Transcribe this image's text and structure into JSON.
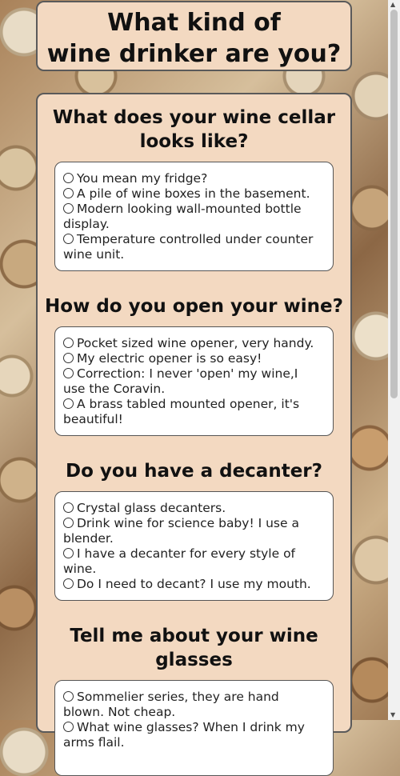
{
  "header": {
    "title_line1": "What kind of",
    "title_line2": "wine drinker are you?"
  },
  "questions": [
    {
      "title_line1": "What does your wine cellar",
      "title_line2": "looks like?",
      "options": [
        "You mean my fridge?",
        "A pile of wine boxes in the basement.",
        "Modern looking wall-mounted bottle",
        "display.",
        "Temperature controlled under counter",
        "wine unit."
      ]
    },
    {
      "title_line1": "How do you open your wine?",
      "options": [
        "Pocket sized wine opener, very handy.",
        "My electric opener is so easy!",
        "Correction: I never 'open' my wine,I",
        "use the Coravin.",
        "A brass tabled mounted opener, it's",
        "beautiful!"
      ]
    },
    {
      "title_line1": "Do you have a decanter?",
      "options": [
        "Crystal glass decanters.",
        "Drink wine for science baby! I use a",
        "blender.",
        "I have a decanter for every style of",
        "wine.",
        "Do I need to decant? I use my mouth."
      ]
    },
    {
      "title_line1": "Tell me about your wine glasses",
      "options": [
        "Sommelier series, they are hand",
        "blown. Not cheap.",
        "What wine glasses? When I drink my",
        "arms flail."
      ]
    }
  ]
}
